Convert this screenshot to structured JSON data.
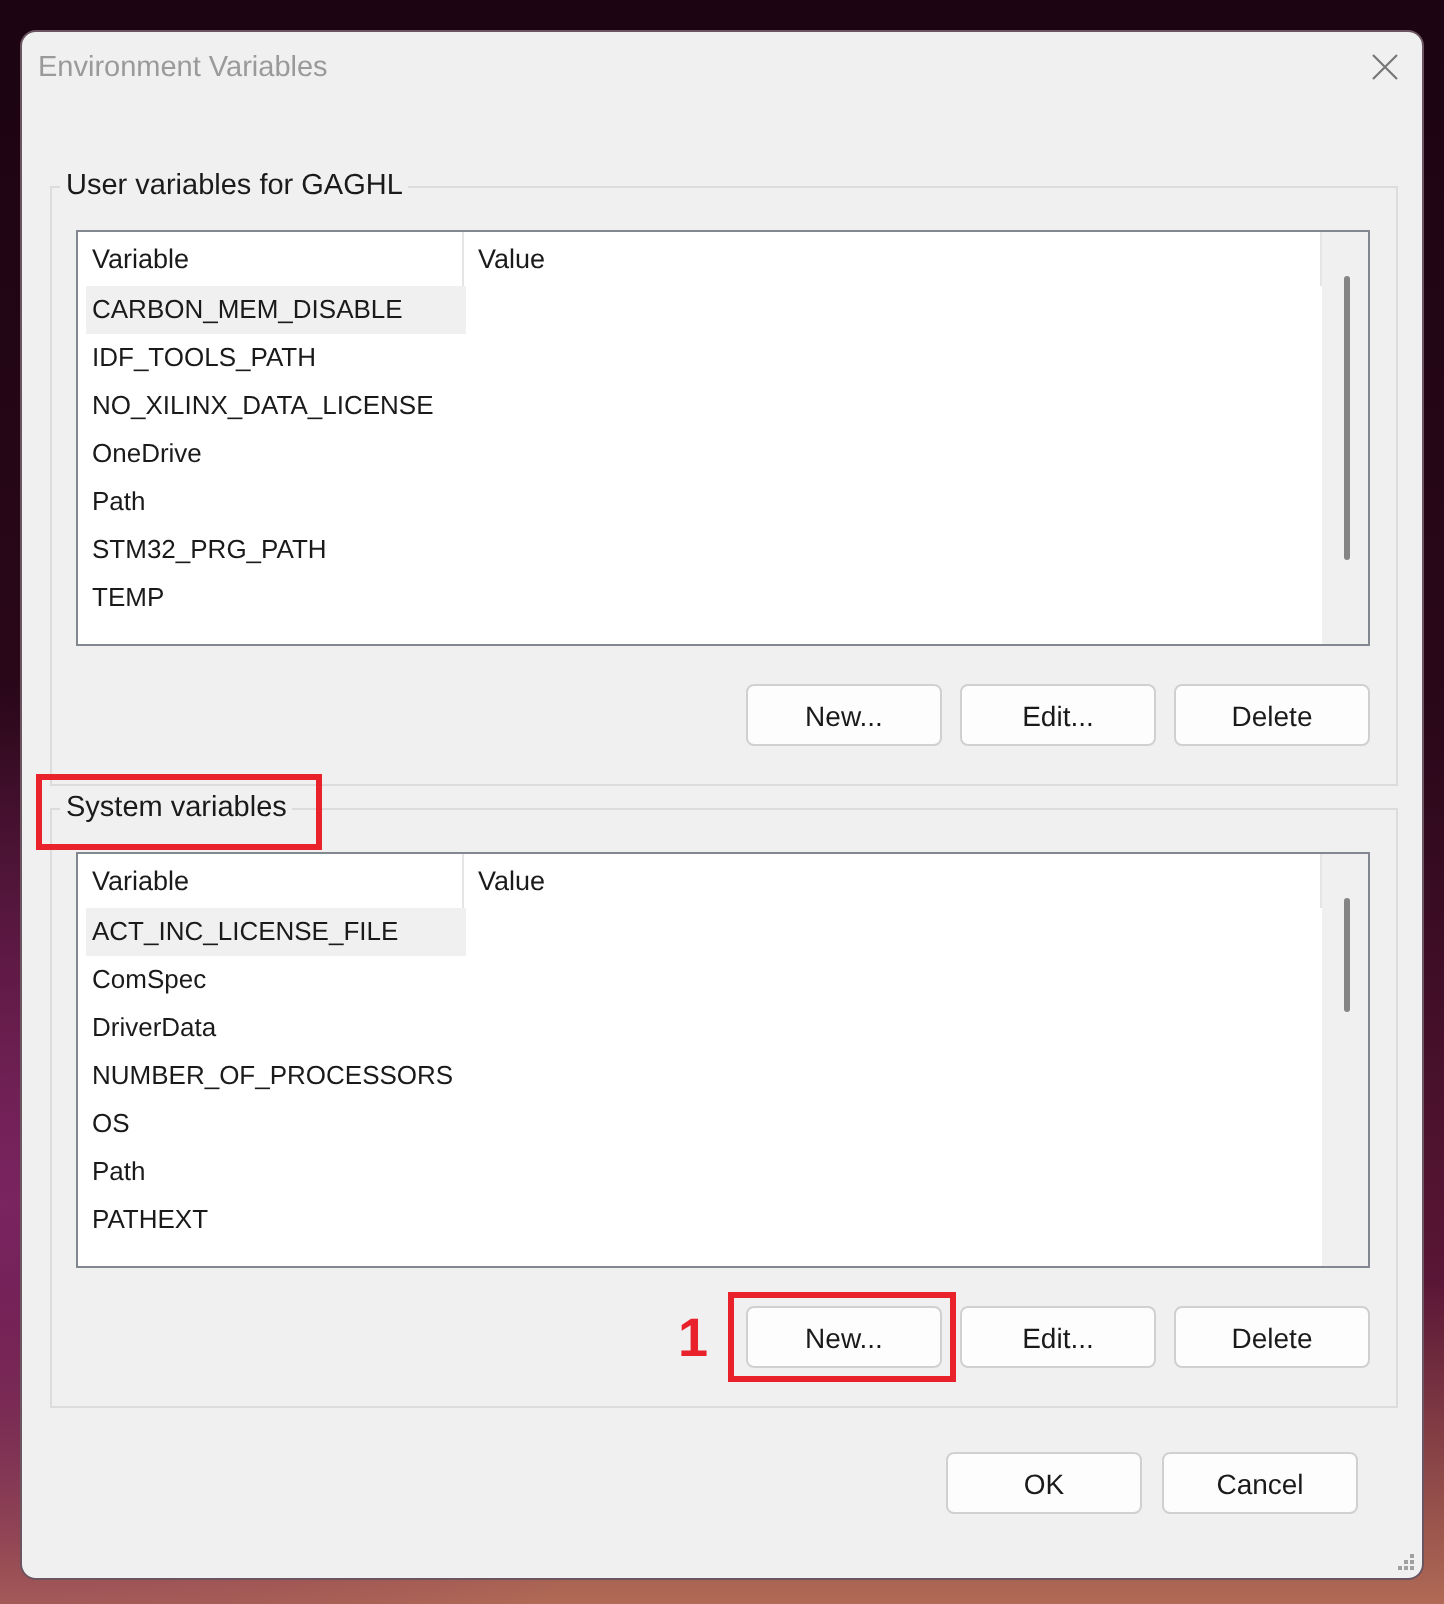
{
  "window": {
    "title": "Environment Variables"
  },
  "user_variables": {
    "title": "User variables for GAGHL",
    "highlighted": false,
    "columns": [
      "Variable",
      "Value"
    ],
    "rows": [
      {
        "variable": "CARBON_MEM_DISABLE",
        "selected": true
      },
      {
        "variable": "IDF_TOOLS_PATH",
        "selected": false
      },
      {
        "variable": "NO_XILINX_DATA_LICENSE",
        "selected": false
      },
      {
        "variable": "OneDrive",
        "selected": false
      },
      {
        "variable": "Path",
        "selected": false
      },
      {
        "variable": "STM32_PRG_PATH",
        "selected": false
      },
      {
        "variable": "TEMP",
        "selected": false
      }
    ],
    "buttons": [
      {
        "label": "New...",
        "highlighted": false
      },
      {
        "label": "Edit...",
        "highlighted": false
      },
      {
        "label": "Delete",
        "highlighted": false
      }
    ]
  },
  "system_variables": {
    "title": "System variables",
    "highlighted": true,
    "columns": [
      "Variable",
      "Value"
    ],
    "rows": [
      {
        "variable": "ACT_INC_LICENSE_FILE",
        "selected": true
      },
      {
        "variable": "ComSpec",
        "selected": false
      },
      {
        "variable": "DriverData",
        "selected": false
      },
      {
        "variable": "NUMBER_OF_PROCESSORS",
        "selected": false
      },
      {
        "variable": "OS",
        "selected": false
      },
      {
        "variable": "Path",
        "selected": false
      },
      {
        "variable": "PATHEXT",
        "selected": false
      }
    ],
    "buttons": [
      {
        "label": "New...",
        "highlighted": true,
        "step": "1"
      },
      {
        "label": "Edit...",
        "highlighted": false
      },
      {
        "label": "Delete",
        "highlighted": false
      }
    ]
  },
  "dialog_buttons": [
    "OK",
    "Cancel"
  ]
}
